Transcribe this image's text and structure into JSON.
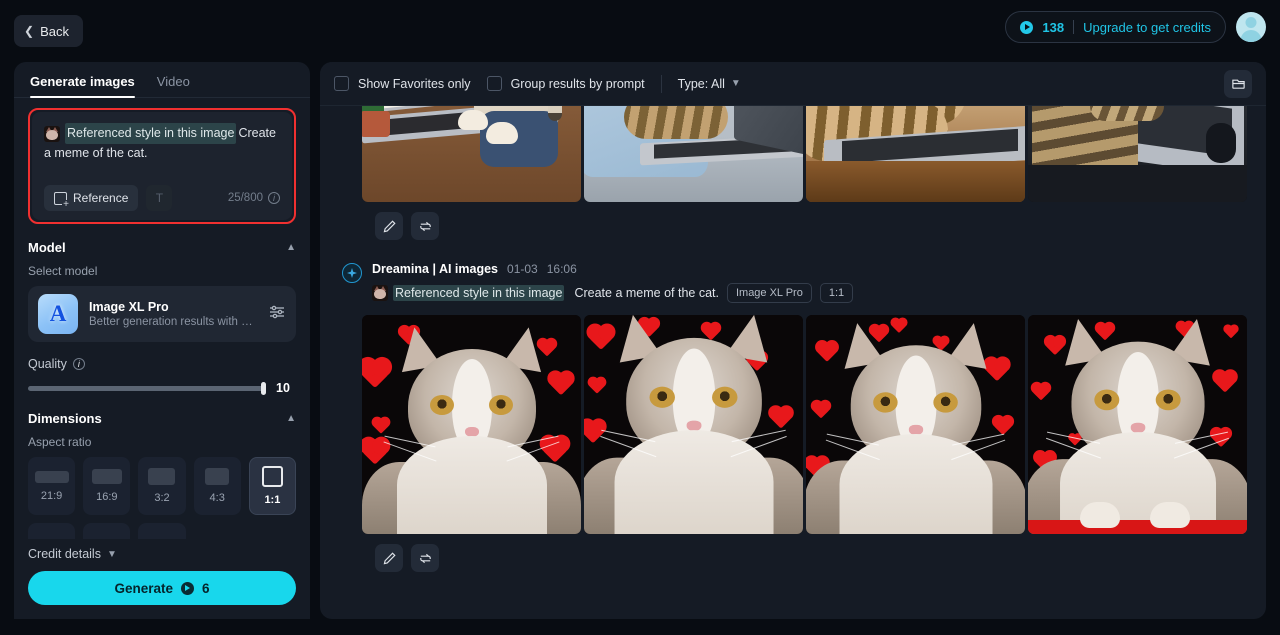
{
  "topbar": {
    "back_label": "Back",
    "credits_count": "138",
    "upgrade_label": "Upgrade to get credits",
    "avatar_name": "user-avatar"
  },
  "left_panel": {
    "tabs": [
      {
        "label": "Generate images",
        "active": true
      },
      {
        "label": "Video",
        "active": false
      }
    ],
    "prompt": {
      "reference_label": "Referenced style in this image",
      "text": "Create a meme of the cat.",
      "reference_button": "Reference",
      "text_tool_icon": "text-style-icon",
      "char_count": "25/800"
    },
    "model_section": {
      "title": "Model",
      "sub_label": "Select model",
      "name": "Image XL Pro",
      "description": "Better generation results with profe…",
      "logo_letter": "A"
    },
    "quality": {
      "label": "Quality",
      "value": "10",
      "fill_percent": 100
    },
    "dimensions": {
      "title": "Dimensions",
      "sub_label": "Aspect ratio",
      "ratios": [
        {
          "label": "21:9",
          "w": 34,
          "h": 12,
          "active": false
        },
        {
          "label": "16:9",
          "w": 30,
          "h": 15,
          "active": false
        },
        {
          "label": "3:2",
          "w": 27,
          "h": 17,
          "active": false
        },
        {
          "label": "4:3",
          "w": 24,
          "h": 17,
          "active": false
        },
        {
          "label": "1:1",
          "w": 21,
          "h": 21,
          "active": true
        }
      ]
    },
    "credit_details_label": "Credit details",
    "generate_label": "Generate",
    "generate_cost": "6"
  },
  "main": {
    "toolbar": {
      "favorites_label": "Show Favorites only",
      "favorites_checked": false,
      "group_label": "Group results by prompt",
      "group_checked": false,
      "type_label": "Type: All",
      "archive_icon": "archive-folder-icon"
    },
    "result_groups": [
      {
        "id": "group-top",
        "partial": true,
        "images": [
          {
            "alt": "cat in sweater typing on laptop with Funnily text",
            "style": "lc1"
          },
          {
            "alt": "tabby cat in blue shirt typing on laptop",
            "style": "lc2"
          },
          {
            "alt": "tabby cat paws on laptop keyboard Funnily",
            "style": "lc3"
          },
          {
            "alt": "tabby cat at desk using laptop and mouse",
            "style": "lc4"
          }
        ],
        "actions": [
          {
            "icon": "edit-pencil-icon",
            "name": "edit-button"
          },
          {
            "icon": "regenerate-icon",
            "name": "regenerate-button"
          }
        ]
      },
      {
        "id": "group-hearts",
        "partial": false,
        "header": {
          "brand": "Dreamina | AI images",
          "date": "01-03",
          "time": "16:06",
          "reference_label": "Referenced style in this image",
          "prompt": "Create a meme of the cat.",
          "tags": [
            "Image XL Pro",
            "1:1"
          ]
        },
        "images": [
          {
            "alt": "cat portrait with red hearts",
            "style": "hc1"
          },
          {
            "alt": "cat portrait with red hearts",
            "style": "hc2"
          },
          {
            "alt": "cat portrait with red hearts",
            "style": "hc3"
          },
          {
            "alt": "cat portrait with red hearts on red bar",
            "style": "hc4"
          }
        ],
        "actions": [
          {
            "icon": "edit-pencil-icon",
            "name": "edit-button"
          },
          {
            "icon": "regenerate-icon",
            "name": "regenerate-button"
          }
        ]
      }
    ]
  },
  "colors": {
    "accent": "#18d7ec",
    "credits_text": "#20c5e6",
    "highlight_border": "#f03030",
    "panel_bg": "#151b25",
    "page_bg": "#080c12"
  }
}
